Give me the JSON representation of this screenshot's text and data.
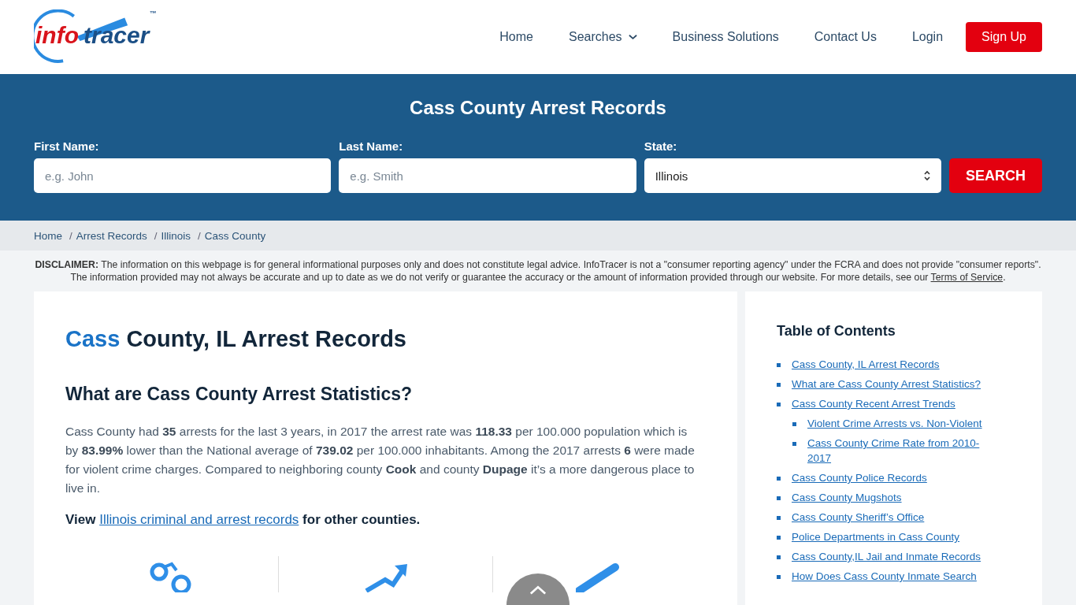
{
  "header": {
    "logo": {
      "part1": "info",
      "part2": "tracer",
      "tm": "™"
    },
    "nav": [
      {
        "label": "Home",
        "kind": "link"
      },
      {
        "label": "Searches",
        "kind": "dropdown"
      },
      {
        "label": "Business Solutions",
        "kind": "link"
      },
      {
        "label": "Contact Us",
        "kind": "link"
      },
      {
        "label": "Login",
        "kind": "link"
      },
      {
        "label": "Sign Up",
        "kind": "cta"
      }
    ]
  },
  "search": {
    "title": "Cass County Arrest Records",
    "fields": [
      {
        "label": "First Name:",
        "placeholder": "e.g. John",
        "kind": "text"
      },
      {
        "label": "Last Name:",
        "placeholder": "e.g. Smith",
        "kind": "text"
      },
      {
        "label": "State:",
        "value": "Illinois",
        "kind": "select"
      }
    ],
    "button": "SEARCH"
  },
  "breadcrumb": {
    "separator": "/",
    "items": [
      "Home",
      "Arrest Records",
      "Illinois",
      "Cass County"
    ]
  },
  "disclaimer": {
    "text": "**DISCLAIMER:** The information on this webpage is for general informational purposes only and does not constitute legal advice. InfoTracer is not a \"consumer reporting agency\" under the FCRA and does not provide \"consumer reports\". The information provided may not always be accurate and up to date as we do not verify or guarantee the accuracy or the amount of information provided through our website. For more details, see our",
    "link": "Terms of Service",
    "after_link": "."
  },
  "article": {
    "title_highlight": "Cass",
    "title_rest": "County, IL Arrest Records",
    "heading": "What are Cass County Arrest Statistics?",
    "paragraph": "Cass County had **35** arrests for the last 3 years, in 2017 the arrest rate was **118.33** per 100.000 population which is by **83.99%** lower than the National average of **739.02** per 100.000 inhabitants. Among the 2017 arrests **6** were made for violent crime charges. Compared to neighboring county **Cook** and county **Dupage** it’s a more dangerous place to live in.",
    "view": {
      "prefix": "View",
      "link": "Illinois criminal and arrest records",
      "suffix": "for other counties."
    },
    "stats": [
      {
        "kind": "handcuffs"
      },
      {
        "kind": "arrow"
      },
      {
        "kind": "baton"
      }
    ]
  },
  "toc": {
    "title": "Table of Contents",
    "items": [
      {
        "label": "Cass County, IL Arrest Records"
      },
      {
        "label": "What are Cass County Arrest Statistics?"
      },
      {
        "label": "Cass County Recent Arrest Trends",
        "children": [
          {
            "label": "Violent Crime Arrests vs. Non-Violent"
          },
          {
            "label": "Cass County Crime Rate from 2010-2017"
          }
        ]
      },
      {
        "label": "Cass County Police Records"
      },
      {
        "label": "Cass County Mugshots"
      },
      {
        "label": "Cass County Sheriff’s Office"
      },
      {
        "label": "Police Departments in Cass County"
      },
      {
        "label": "Cass County,IL Jail and Inmate Records"
      },
      {
        "label": "How Does Cass County Inmate Search"
      }
    ]
  }
}
